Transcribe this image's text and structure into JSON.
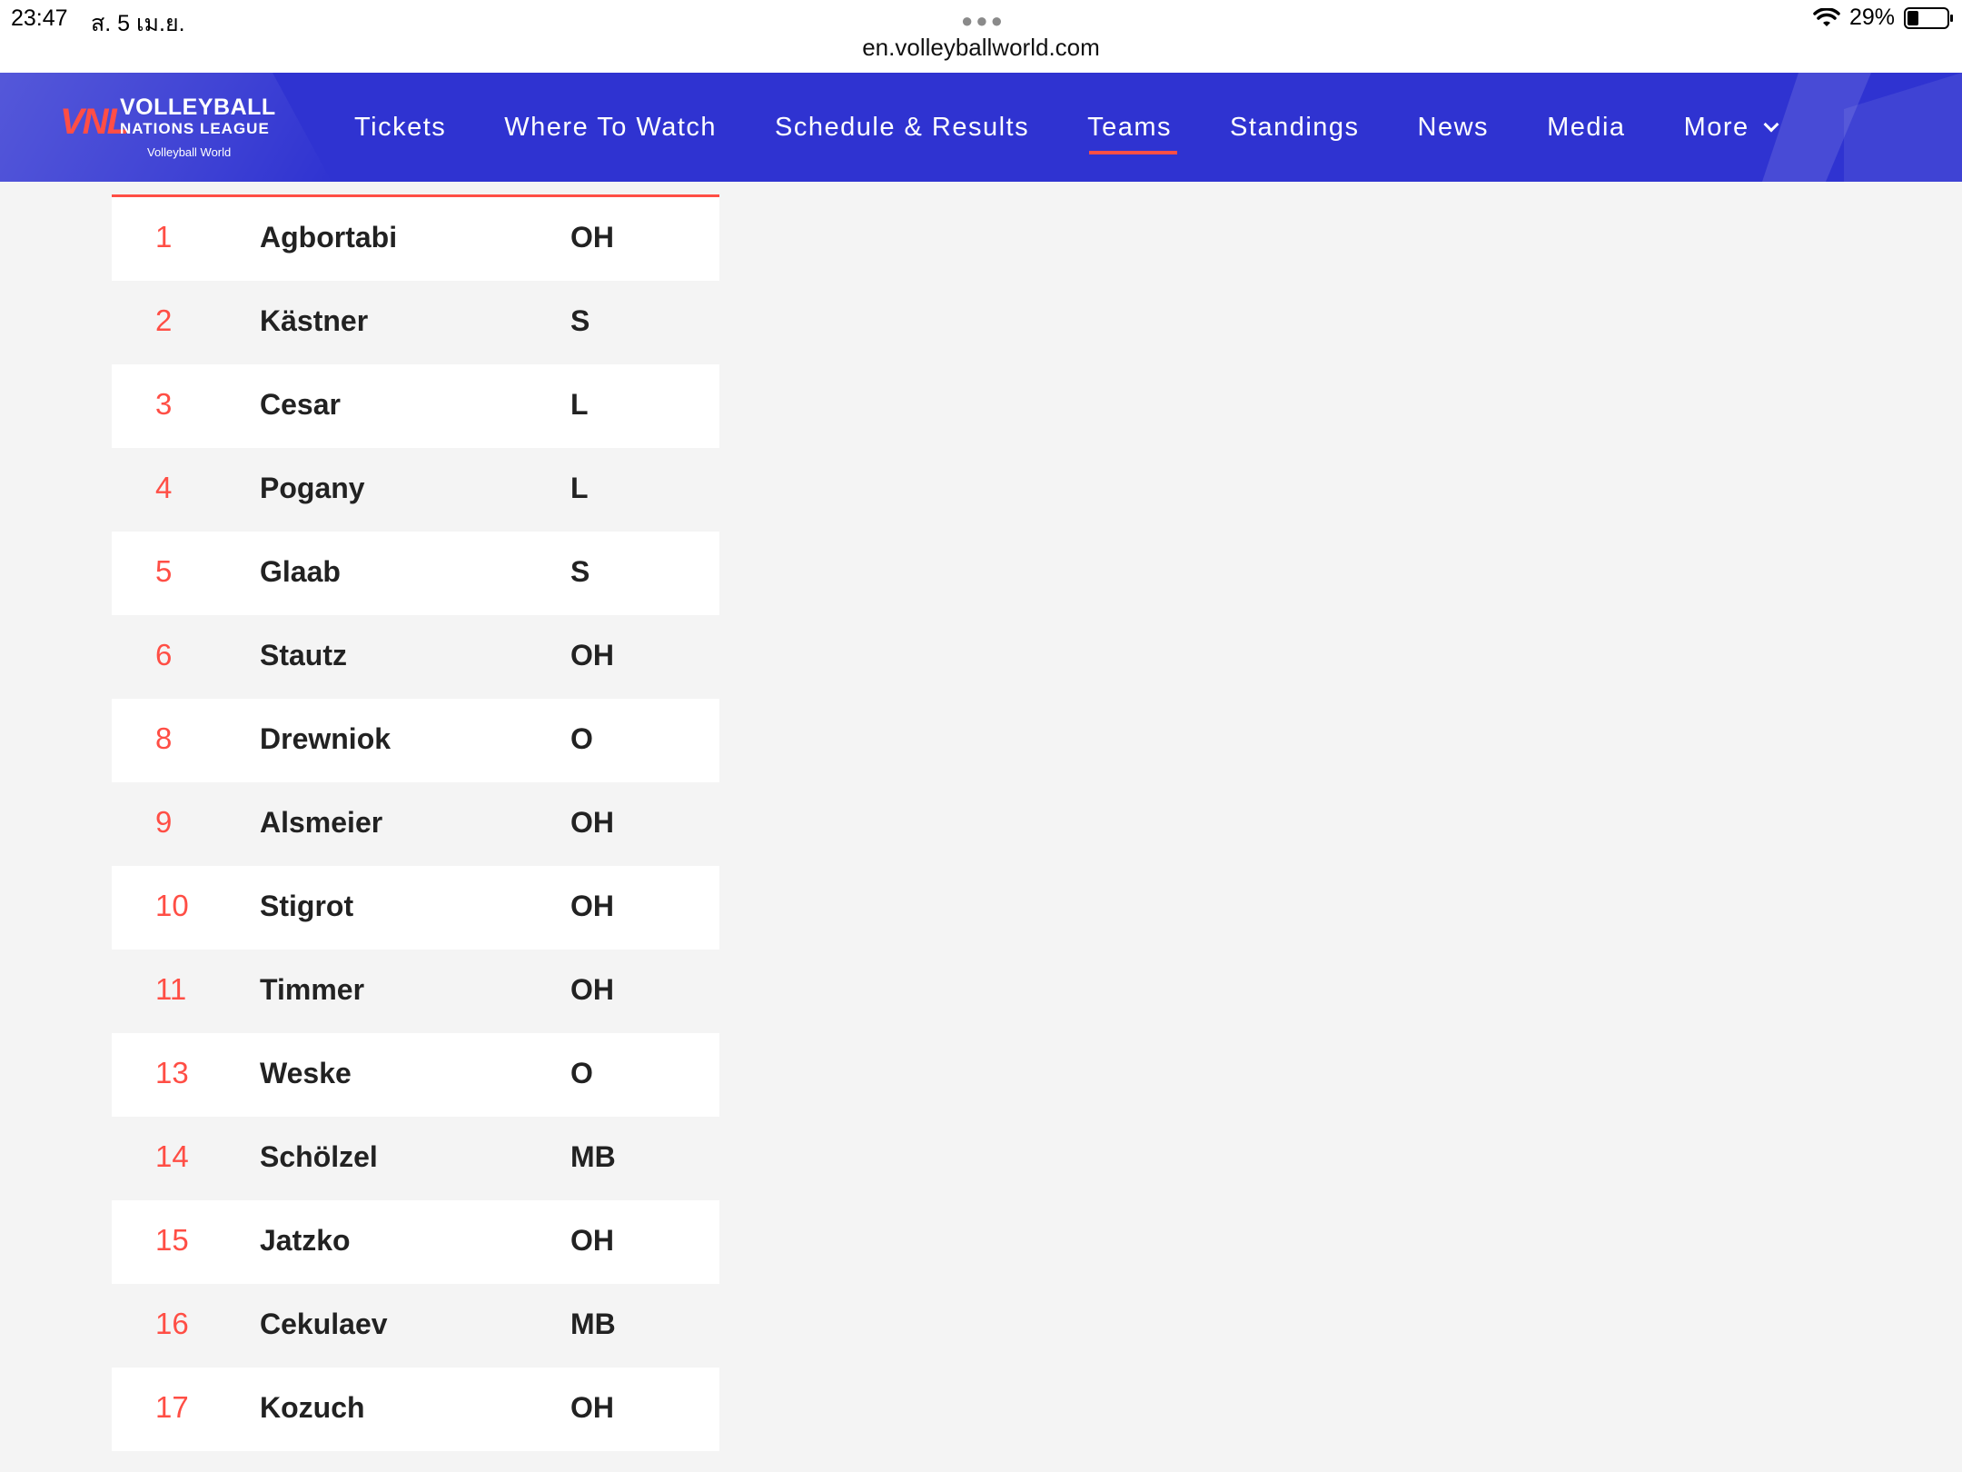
{
  "status_bar": {
    "time": "23:47",
    "date": "ส. 5 เม.ย.",
    "url": "en.volleyballworld.com",
    "battery": "29%",
    "battery_level": 0.29
  },
  "logo": {
    "mark": "VNL",
    "line1": "VOLLEYBALL",
    "line2": "NATIONS LEAGUE",
    "line3": "Volleyball World"
  },
  "nav": {
    "items": [
      {
        "label": "Tickets"
      },
      {
        "label": "Where To Watch"
      },
      {
        "label": "Schedule & Results"
      },
      {
        "label": "Teams",
        "active": true
      },
      {
        "label": "Standings"
      },
      {
        "label": "News"
      },
      {
        "label": "Media"
      },
      {
        "label": "More"
      }
    ]
  },
  "colors": {
    "nav_bg": "#2f33d1",
    "accent": "#ff4e45"
  },
  "roster": [
    {
      "number": "1",
      "name": "Agbortabi",
      "position": "OH"
    },
    {
      "number": "2",
      "name": "Kästner",
      "position": "S"
    },
    {
      "number": "3",
      "name": "Cesar",
      "position": "L"
    },
    {
      "number": "4",
      "name": "Pogany",
      "position": "L"
    },
    {
      "number": "5",
      "name": "Glaab",
      "position": "S"
    },
    {
      "number": "6",
      "name": "Stautz",
      "position": "OH"
    },
    {
      "number": "8",
      "name": "Drewniok",
      "position": "O"
    },
    {
      "number": "9",
      "name": "Alsmeier",
      "position": "OH"
    },
    {
      "number": "10",
      "name": "Stigrot",
      "position": "OH"
    },
    {
      "number": "11",
      "name": "Timmer",
      "position": "OH"
    },
    {
      "number": "13",
      "name": "Weske",
      "position": "O"
    },
    {
      "number": "14",
      "name": "Schölzel",
      "position": "MB"
    },
    {
      "number": "15",
      "name": "Jatzko",
      "position": "OH"
    },
    {
      "number": "16",
      "name": "Cekulaev",
      "position": "MB"
    },
    {
      "number": "17",
      "name": "Kozuch",
      "position": "OH"
    }
  ]
}
